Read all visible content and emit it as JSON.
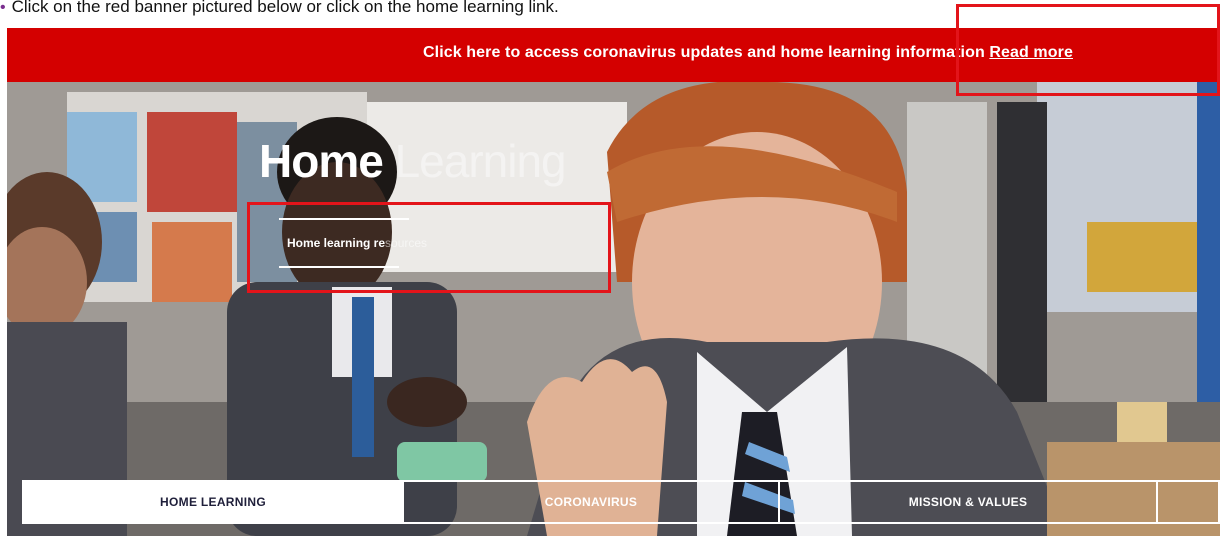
{
  "instruction": {
    "text": "Click on the red banner pictured below or click on the home learning link."
  },
  "banner": {
    "text": "Click here to access coronavirus updates and home learning information",
    "link": "Read more",
    "color": "#d40000"
  },
  "hero": {
    "title_main": "Home",
    "title_faded": "Learning",
    "link_main": "Home learning re",
    "link_faded": "sources"
  },
  "nav": {
    "tabs": [
      {
        "label": "HOME LEARNING",
        "active": true
      },
      {
        "label": "CORONAVIRUS",
        "active": false
      },
      {
        "label": "MISSION & VALUES",
        "active": false
      }
    ]
  },
  "colors": {
    "highlight": "#e3141a",
    "nav_active_text": "#1f1f3a"
  }
}
